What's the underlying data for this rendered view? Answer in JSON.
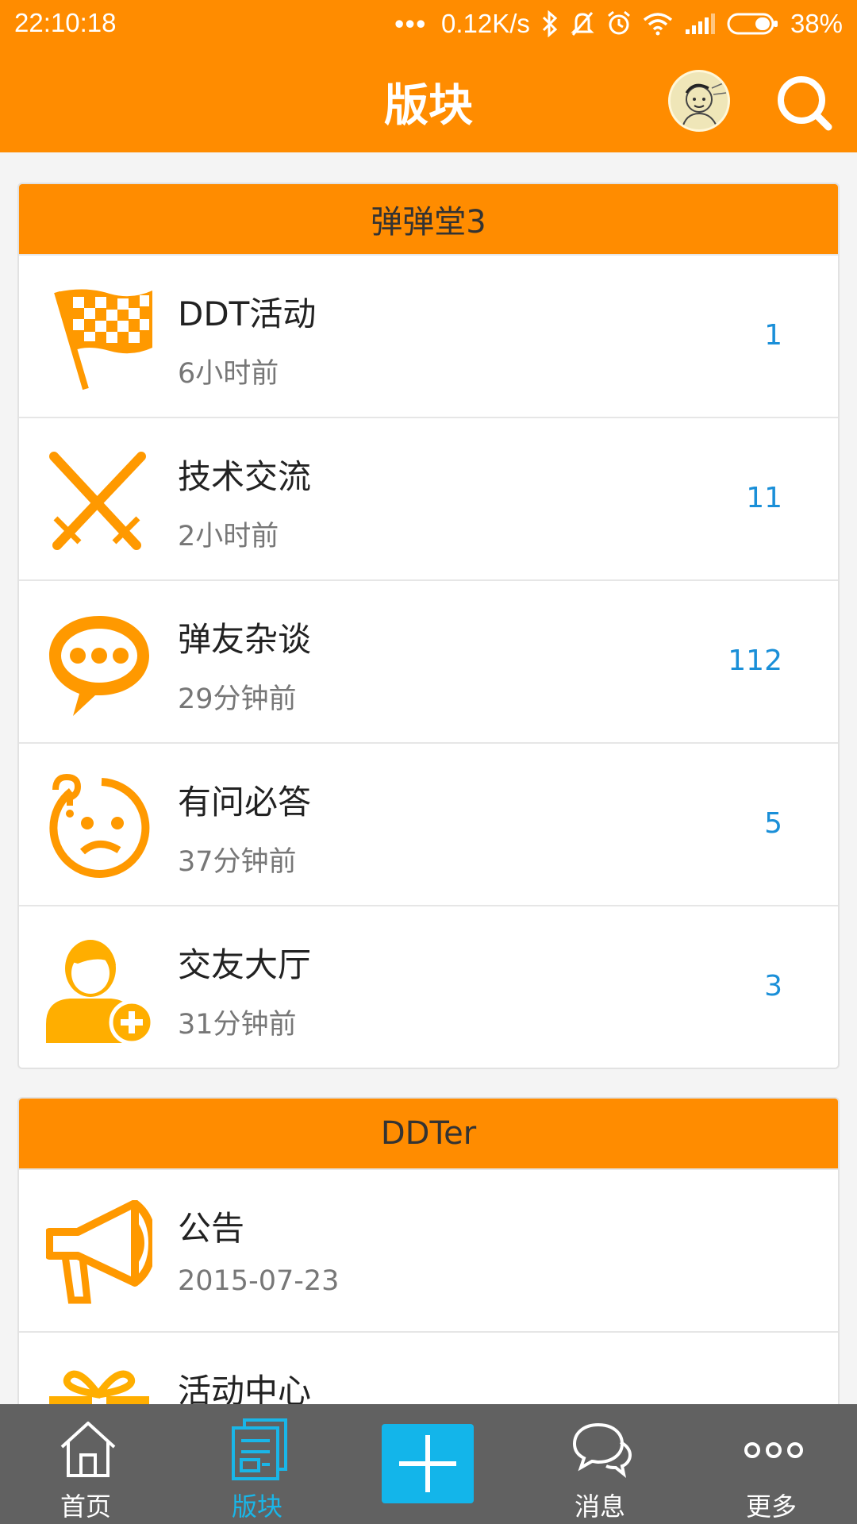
{
  "status_bar": {
    "time": "22:10:18",
    "net_speed": "0.12K/s",
    "battery": "38%"
  },
  "header": {
    "title": "版块"
  },
  "sections": [
    {
      "title": "弹弹堂3",
      "items": [
        {
          "title": "DDT活动",
          "time": "6小时前",
          "count": "1",
          "icon": "checkered-flag-icon"
        },
        {
          "title": "技术交流",
          "time": "2小时前",
          "count": "11",
          "icon": "crossed-swords-icon"
        },
        {
          "title": "弹友杂谈",
          "time": "29分钟前",
          "count": "112",
          "icon": "chat-bubble-icon"
        },
        {
          "title": "有问必答",
          "time": "37分钟前",
          "count": "5",
          "icon": "confused-face-icon"
        },
        {
          "title": "交友大厅",
          "time": "31分钟前",
          "count": "3",
          "icon": "add-friend-icon"
        }
      ]
    },
    {
      "title": "DDTer",
      "items": [
        {
          "title": "公告",
          "time": "2015-07-23",
          "icon": "megaphone-icon"
        },
        {
          "title": "活动中心",
          "icon": "gift-icon"
        }
      ]
    }
  ],
  "bottom_nav": {
    "items": [
      {
        "label": "首页",
        "icon": "home-icon"
      },
      {
        "label": "版块",
        "icon": "forum-board-icon",
        "active": true
      },
      {
        "label": "",
        "icon": "plus-icon"
      },
      {
        "label": "消息",
        "icon": "message-bubbles-icon"
      },
      {
        "label": "更多",
        "icon": "more-dots-icon"
      }
    ]
  },
  "colors": {
    "accent": "#ff8c00",
    "count_blue": "#1a8fd8",
    "nav_active": "#19b6e8",
    "nav_bg": "#616161"
  }
}
